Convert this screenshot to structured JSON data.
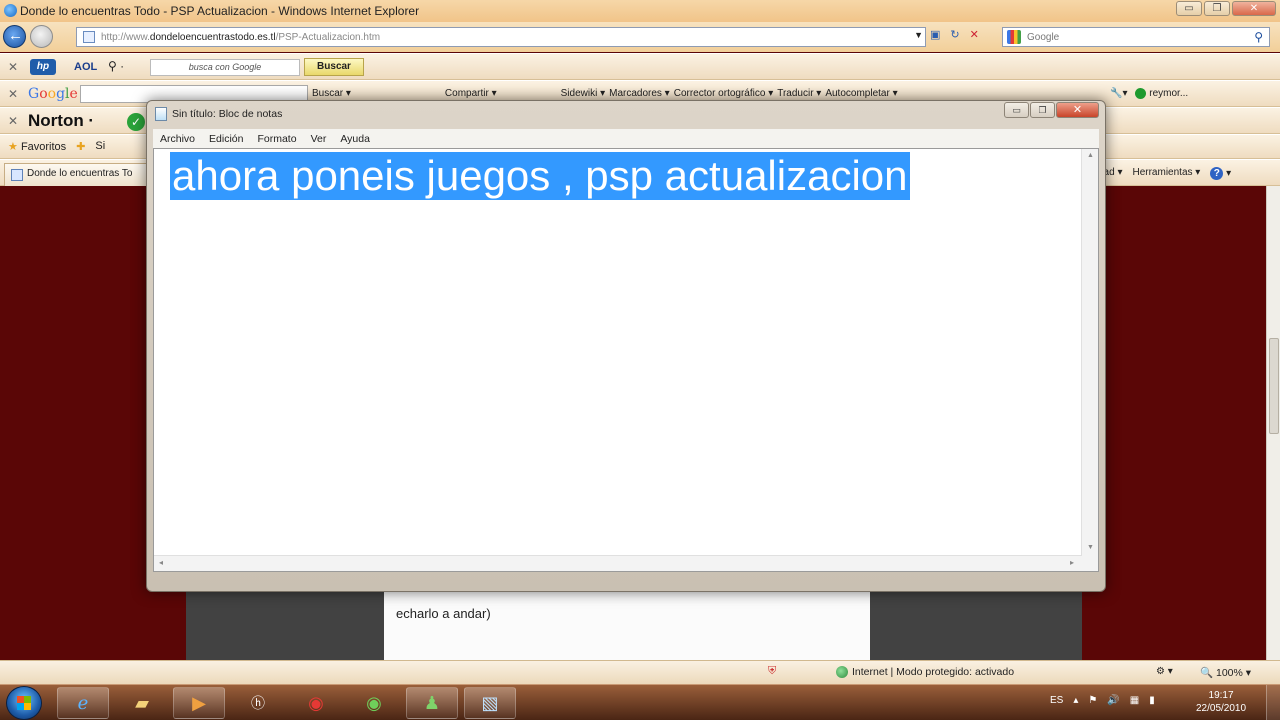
{
  "ie": {
    "title": "Donde lo encuentras Todo - PSP Actualizacion - Windows Internet Explorer",
    "url_prefix": "http://www.",
    "url_domain": "dondeloencuentrastodo.es.tl",
    "url_path": "/PSP-Actualizacion.htm",
    "search_placeholder": "Google"
  },
  "toolbars": {
    "aol_label": "AOL",
    "aol_search_hint": "busca con Google",
    "aol_search_button": "Buscar",
    "google_logo": [
      "G",
      "o",
      "o",
      "g",
      "l",
      "e"
    ],
    "google_items": [
      "Buscar ▾",
      "Compartir ▾",
      "Sidewiki ▾",
      "Marcadores ▾",
      "Corrector ortográfico ▾",
      "Traducir ▾",
      "Autocompletar ▾"
    ],
    "google_user": "reymor...",
    "norton_label": "Norton ·",
    "favoritos_label": "Favoritos",
    "favoritos_extra": "Si",
    "tab_label": "Donde lo encuentras To",
    "cmd_items": [
      "dad ▾",
      "Herramientas ▾"
    ]
  },
  "page": {
    "text_line": "echarlo a andar)"
  },
  "statusbar": {
    "zone": "Internet | Modo protegido: activado",
    "zoom": "100% ▾"
  },
  "notepad": {
    "title": "Sin título: Bloc de notas",
    "menu": [
      "Archivo",
      "Edición",
      "Formato",
      "Ver",
      "Ayuda"
    ],
    "content": "ahora poneis juegos , psp actualizacion"
  },
  "taskbar": {
    "lang": "ES",
    "time": "19:17",
    "date": "22/05/2010"
  }
}
